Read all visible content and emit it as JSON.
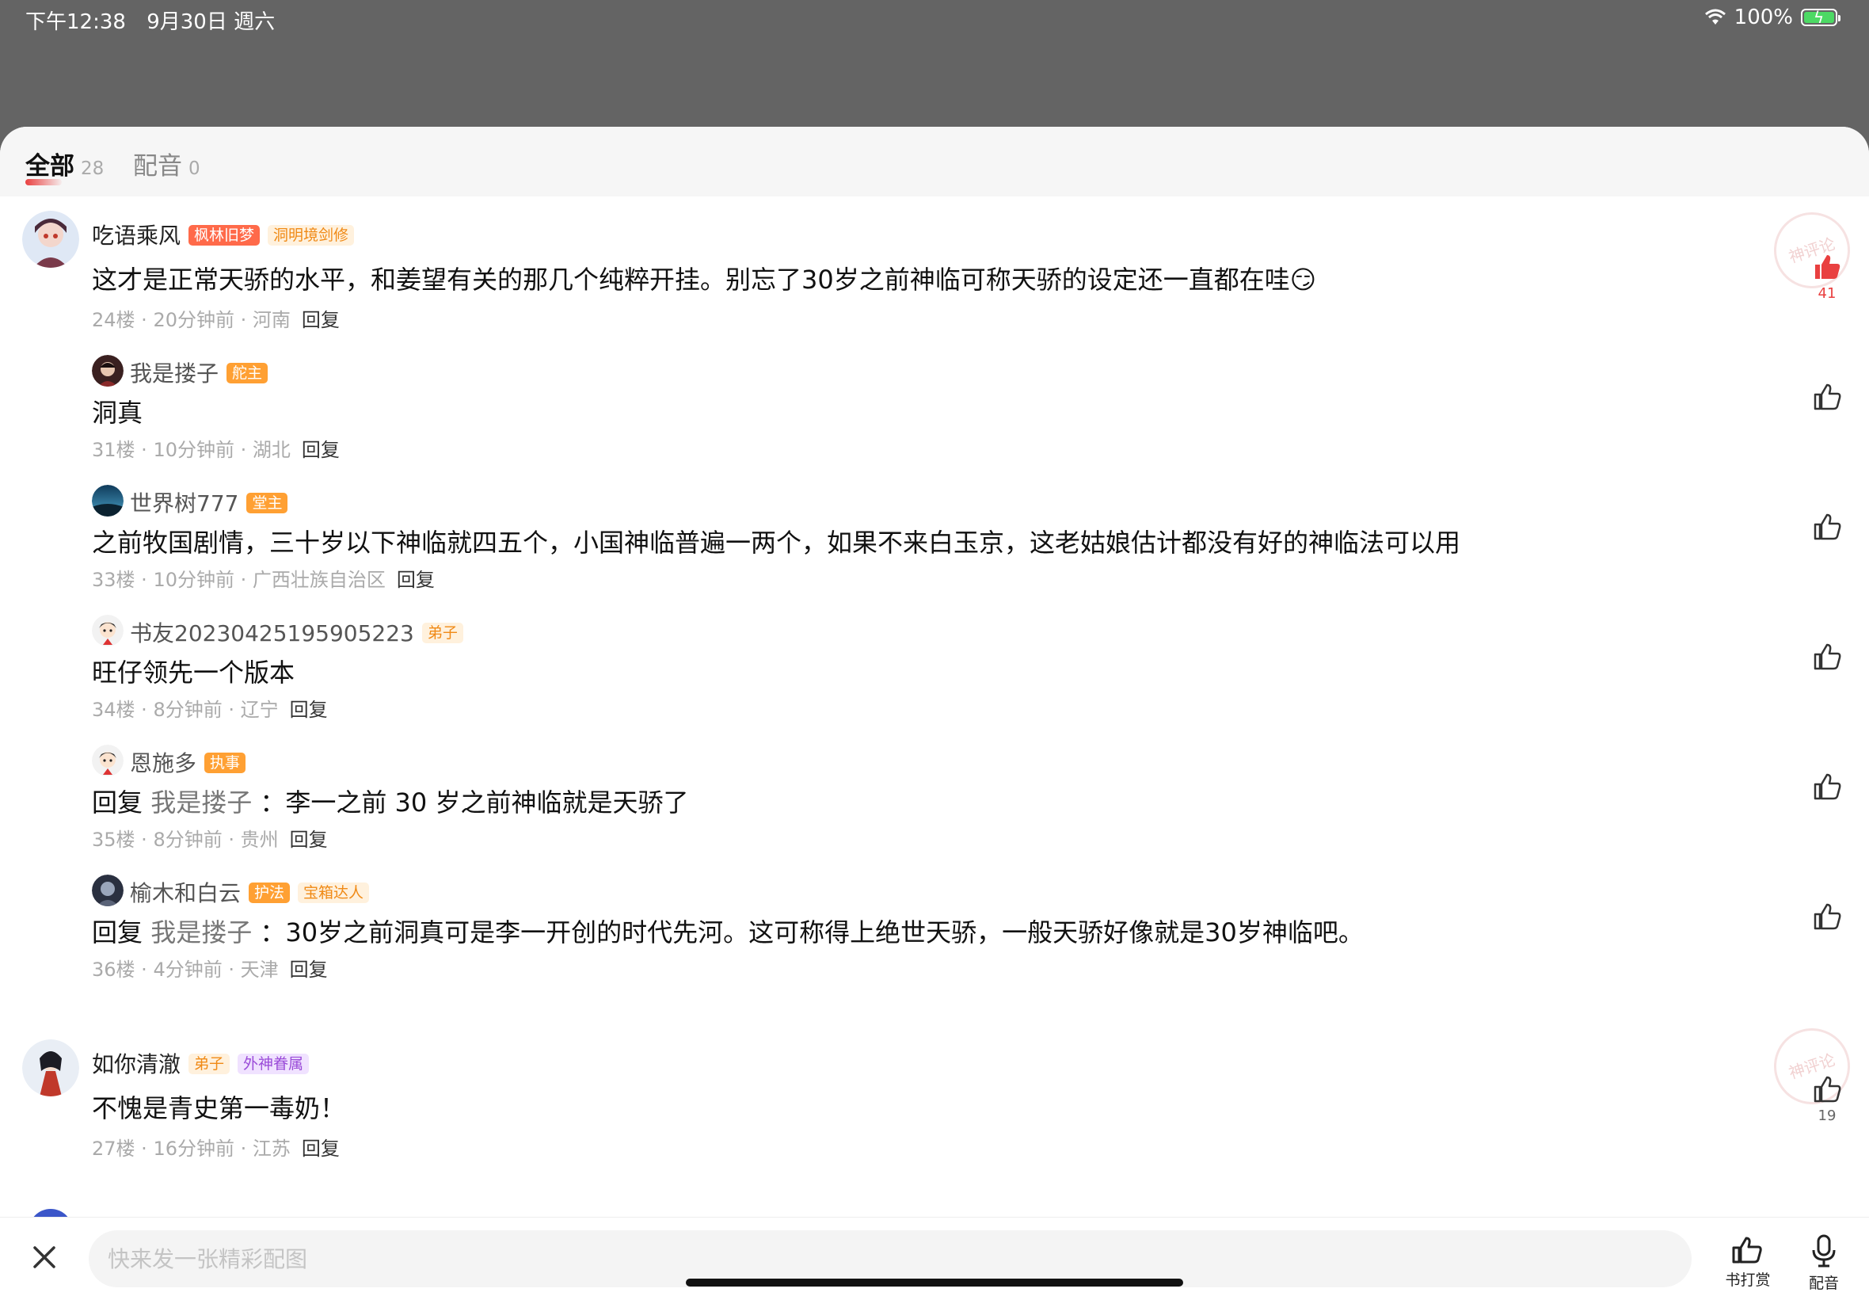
{
  "status_bar": {
    "time": "下午12:38",
    "date": "9月30日 週六",
    "battery": "100%"
  },
  "tabs": [
    {
      "label": "全部",
      "count": "28"
    },
    {
      "label": "配音",
      "count": "0"
    }
  ],
  "threads": [
    {
      "user": "吃语乘风",
      "badges": [
        "枫林旧梦",
        "洞明境剑修"
      ],
      "content": "这才是正常天骄的水平，和姜望有关的那几个纯粹开挂。别忘了30岁之前神临可称天骄的设定还一直都在哇😏",
      "floor": "24楼",
      "time": "20分钟前",
      "location": "河南",
      "reply": "回复",
      "likes": "41",
      "stamp": "神评论",
      "replies": [
        {
          "user": "我是搂子",
          "badges": [
            "舵主"
          ],
          "content": "洞真",
          "floor": "31楼",
          "time": "10分钟前",
          "location": "湖北",
          "reply": "回复"
        },
        {
          "user": "世界树777",
          "badges": [
            "堂主"
          ],
          "content": "之前牧国剧情，三十岁以下神临就四五个，小国神临普遍一两个，如果不来白玉京，这老姑娘估计都没有好的神临法可以用",
          "floor": "33楼",
          "time": "10分钟前",
          "location": "广西壮族自治区",
          "reply": "回复"
        },
        {
          "user": "书友20230425195905223",
          "badges": [
            "弟子"
          ],
          "content": "旺仔领先一个版本",
          "floor": "34楼",
          "time": "8分钟前",
          "location": "辽宁",
          "reply": "回复"
        },
        {
          "user": "恩施多",
          "badges": [
            "执事"
          ],
          "reply_prefix": "回复",
          "reply_to": "我是搂子",
          "content": "：李一之前 30 岁之前神临就是天骄了",
          "floor": "35楼",
          "time": "8分钟前",
          "location": "贵州",
          "reply": "回复"
        },
        {
          "user": "榆木和白云",
          "badges": [
            "护法",
            "宝箱达人"
          ],
          "reply_prefix": "回复",
          "reply_to": "我是搂子",
          "content": "：30岁之前洞真可是李一开创的时代先河。这可称得上绝世天骄，一般天骄好像就是30岁神临吧。",
          "floor": "36楼",
          "time": "4分钟前",
          "location": "天津",
          "reply": "回复"
        }
      ]
    },
    {
      "user": "如你清澈",
      "badges": [
        "弟子",
        "外神眷属"
      ],
      "content": "不愧是青史第一毒奶！",
      "floor": "27楼",
      "time": "16分钟前",
      "location": "江苏",
      "reply": "回复",
      "likes": "19",
      "stamp": "神评论"
    }
  ],
  "bottom_bar": {
    "input_placeholder": "快来发一张精彩配图",
    "tip_label": "书打赏",
    "voice_label": "配音"
  },
  "colors": {
    "accent": "#e94040",
    "badge_red": "#ff6a4a",
    "badge_orange": "#ffa033",
    "badge_purple": "#9a4bd8"
  },
  "icons": [
    "wifi-icon",
    "battery-icon",
    "thumbs-up-icon",
    "close-icon",
    "tip-icon",
    "microphone-icon"
  ]
}
